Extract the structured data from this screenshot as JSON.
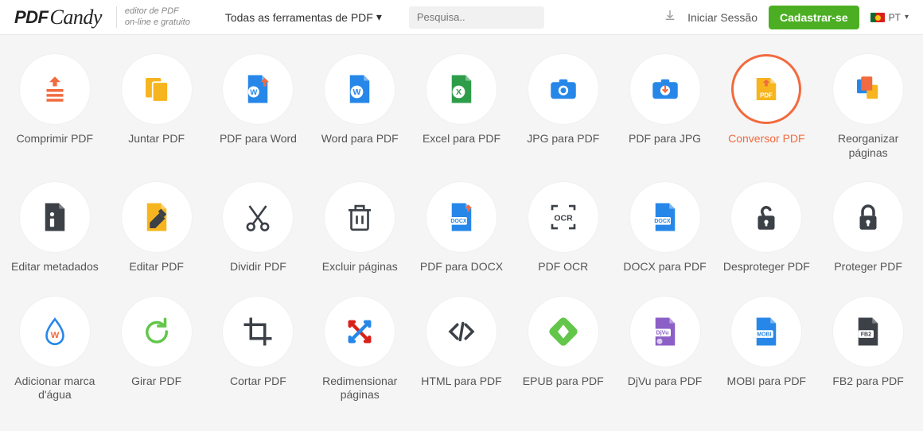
{
  "header": {
    "logo_pdf": "PDF",
    "logo_candy": "Candy",
    "tagline_l1": "editor de PDF",
    "tagline_l2": "on-line e gratuito",
    "tools_dropdown": "Todas as ferramentas de PDF",
    "search_placeholder": "Pesquisa..",
    "login": "Iniciar Sessão",
    "signup": "Cadastrar-se",
    "language": "PT"
  },
  "tools": [
    {
      "id": "compress-pdf",
      "label": "Comprimir PDF",
      "icon": "compress",
      "highlight": false
    },
    {
      "id": "merge-pdf",
      "label": "Juntar PDF",
      "icon": "merge",
      "highlight": false
    },
    {
      "id": "pdf-to-word",
      "label": "PDF para Word",
      "icon": "wordin",
      "highlight": false
    },
    {
      "id": "word-to-pdf",
      "label": "Word para PDF",
      "icon": "word",
      "highlight": false
    },
    {
      "id": "excel-to-pdf",
      "label": "Excel para PDF",
      "icon": "excel",
      "highlight": false
    },
    {
      "id": "jpg-to-pdf",
      "label": "JPG para PDF",
      "icon": "camera",
      "highlight": false
    },
    {
      "id": "pdf-to-jpg",
      "label": "PDF para JPG",
      "icon": "cameradl",
      "highlight": false
    },
    {
      "id": "pdf-converter",
      "label": "Conversor PDF",
      "icon": "convert",
      "highlight": true
    },
    {
      "id": "reorganize",
      "label": "Reorganizar páginas",
      "icon": "rearrange",
      "highlight": false
    },
    {
      "id": "edit-metadata",
      "label": "Editar metadados",
      "icon": "metadata",
      "highlight": false
    },
    {
      "id": "edit-pdf",
      "label": "Editar PDF",
      "icon": "editpdf",
      "highlight": false
    },
    {
      "id": "split-pdf",
      "label": "Dividir PDF",
      "icon": "scissors",
      "highlight": false
    },
    {
      "id": "delete-pages",
      "label": "Excluir páginas",
      "icon": "trash",
      "highlight": false
    },
    {
      "id": "pdf-to-docx",
      "label": "PDF para DOCX",
      "icon": "docxin",
      "highlight": false
    },
    {
      "id": "pdf-ocr",
      "label": "PDF OCR",
      "icon": "ocr",
      "highlight": false
    },
    {
      "id": "docx-to-pdf",
      "label": "DOCX para PDF",
      "icon": "docx",
      "highlight": false
    },
    {
      "id": "unlock-pdf",
      "label": "Desproteger PDF",
      "icon": "unlock",
      "highlight": false
    },
    {
      "id": "protect-pdf",
      "label": "Proteger PDF",
      "icon": "lock",
      "highlight": false
    },
    {
      "id": "watermark",
      "label": "Adicionar marca d'água",
      "icon": "watermark",
      "highlight": false
    },
    {
      "id": "rotate-pdf",
      "label": "Girar PDF",
      "icon": "rotate",
      "highlight": false
    },
    {
      "id": "crop-pdf",
      "label": "Cortar PDF",
      "icon": "crop",
      "highlight": false
    },
    {
      "id": "resize-pdf",
      "label": "Redimensionar páginas",
      "icon": "resize",
      "highlight": false
    },
    {
      "id": "html-to-pdf",
      "label": "HTML para PDF",
      "icon": "html",
      "highlight": false
    },
    {
      "id": "epub-to-pdf",
      "label": "EPUB para PDF",
      "icon": "epub",
      "highlight": false
    },
    {
      "id": "djvu-to-pdf",
      "label": "DjVu para PDF",
      "icon": "djvu",
      "highlight": false
    },
    {
      "id": "mobi-to-pdf",
      "label": "MOBI para PDF",
      "icon": "mobi",
      "highlight": false
    },
    {
      "id": "fb2-to-pdf",
      "label": "FB2 para PDF",
      "icon": "fb2",
      "highlight": false
    }
  ],
  "colors": {
    "accent_orange": "#f26a3f",
    "signup_green": "#4caf23",
    "word_blue": "#2787e8",
    "excel_green": "#2e9d4a",
    "docx_blue": "#2787e8",
    "mobi_blue": "#2787e8",
    "fb2_dark": "#3c4047",
    "djvu_purple": "#8b5fc6",
    "epub_green": "#63c64b",
    "dark": "#3c4047"
  }
}
